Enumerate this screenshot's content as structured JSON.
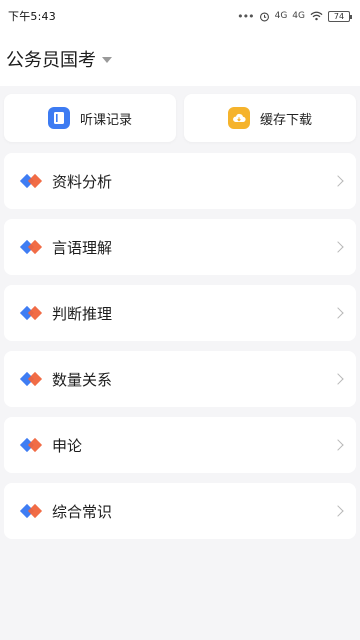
{
  "status_bar": {
    "time": "下午5:43",
    "signal_1": "4G",
    "signal_2": "4G",
    "battery": "74"
  },
  "header": {
    "exam_title": "公务员国考"
  },
  "actions": [
    {
      "label": "听课记录",
      "icon": "notebook-icon",
      "color": "#3d7bf2"
    },
    {
      "label": "缓存下载",
      "icon": "cloud-download-icon",
      "color": "#f5b32c"
    }
  ],
  "categories": [
    {
      "label": "资料分析"
    },
    {
      "label": "言语理解"
    },
    {
      "label": "判断推理"
    },
    {
      "label": "数量关系"
    },
    {
      "label": "申论"
    },
    {
      "label": "综合常识"
    }
  ],
  "colors": {
    "accent_blue": "#3f7df3",
    "accent_orange": "#f0643c",
    "background": "#f5f5f7"
  }
}
